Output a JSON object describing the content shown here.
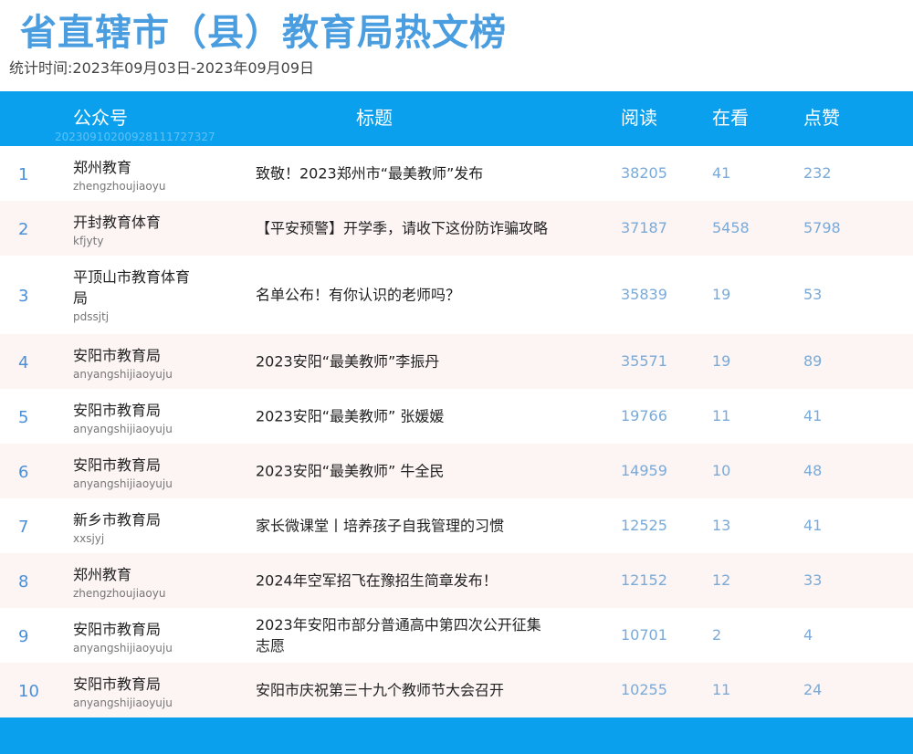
{
  "page_title": "省直辖市（县）教育局热文榜",
  "period": "统计时间:2023年09月03日-2023年09月09日",
  "header": {
    "account": "公众号",
    "title": "标题",
    "read": "阅读",
    "looking": "在看",
    "like": "点赞",
    "watermark": "20230910200928111727327"
  },
  "rows": [
    {
      "rank": "1",
      "name": "郑州教育",
      "id": "zhengzhoujiaoyu",
      "title": "致敬！2023郑州市“最美教师”发布",
      "read": "38205",
      "looking": "41",
      "like": "232"
    },
    {
      "rank": "2",
      "name": "开封教育体育",
      "id": "kfjyty",
      "title": "【平安预警】开学季，请收下这份防诈骗攻略",
      "read": "37187",
      "looking": "5458",
      "like": "5798"
    },
    {
      "rank": "3",
      "name": "平顶山市教育体育局",
      "id": "pdssjtj",
      "title": "名单公布！有你认识的老师吗？",
      "read": "35839",
      "looking": "19",
      "like": "53"
    },
    {
      "rank": "4",
      "name": "安阳市教育局",
      "id": "anyangshijiaoyuju",
      "title": "2023安阳“最美教师”李振丹",
      "read": "35571",
      "looking": "19",
      "like": "89"
    },
    {
      "rank": "5",
      "name": "安阳市教育局",
      "id": "anyangshijiaoyuju",
      "title": "2023安阳“最美教师” 张媛媛",
      "read": "19766",
      "looking": "11",
      "like": "41"
    },
    {
      "rank": "6",
      "name": "安阳市教育局",
      "id": "anyangshijiaoyuju",
      "title": "2023安阳“最美教师” 牛全民",
      "read": "14959",
      "looking": "10",
      "like": "48"
    },
    {
      "rank": "7",
      "name": "新乡市教育局",
      "id": "xxsjyj",
      "title": "家长微课堂丨培养孩子自我管理的习惯",
      "read": "12525",
      "looking": "13",
      "like": "41"
    },
    {
      "rank": "8",
      "name": "郑州教育",
      "id": "zhengzhoujiaoyu",
      "title": "2024年空军招飞在豫招生简章发布！",
      "read": "12152",
      "looking": "12",
      "like": "33"
    },
    {
      "rank": "9",
      "name": "安阳市教育局",
      "id": "anyangshijiaoyuju",
      "title": "2023年安阳市部分普通高中第四次公开征集志愿",
      "read": "10701",
      "looking": "2",
      "like": "4"
    },
    {
      "rank": "10",
      "name": "安阳市教育局",
      "id": "anyangshijiaoyuju",
      "title": "安阳市庆祝第三十九个教师节大会召开",
      "read": "10255",
      "looking": "11",
      "like": "24"
    }
  ]
}
